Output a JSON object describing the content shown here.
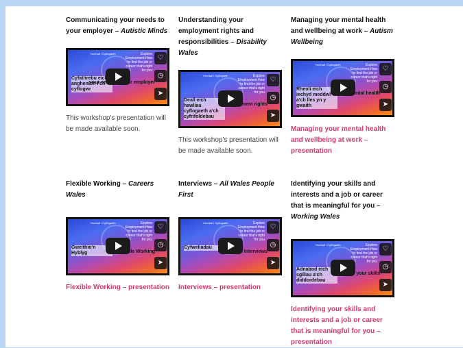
{
  "cards": [
    {
      "title_main": "Communicating your needs to your employer – ",
      "title_org": "Autistic Minds",
      "thumb_big": "Cyfathrebu eich anghenion i'ch cyflogwr",
      "thumb_right": "your needs to your employer",
      "footer": "This workshop's presentation will be made available soon."
    },
    {
      "title_main": "Understanding your employment rights and responsibilities – ",
      "title_org": "Disability Wales",
      "thumb_big": "Deall eich hawliau cyflogaeth a'ch cyfrifoldebau",
      "thumb_right": "employment rights",
      "footer": "This workshop's presentation will be made available soon."
    },
    {
      "title_main": "Managing your mental health and wellbeing at work – ",
      "title_org": "Autism Wellbeing",
      "thumb_big": "Rheoli eich iechyd meddwl a'ch lles yn y gwaith",
      "thumb_right": "mental health",
      "footer": "Managing your mental health and wellbeing at work – presentation"
    },
    {
      "title_main": "Flexible Working – ",
      "title_org": "Careers Wales",
      "thumb_big": "Gweithio'n Hyblyg",
      "thumb_right": "Flexible Working",
      "footer": "Flexible Working – presentation"
    },
    {
      "title_main": "Interviews – ",
      "title_org": "All Wales People First",
      "thumb_big": "Cyfweliadau",
      "thumb_right": "Interviews",
      "footer": "Interviews – presentation"
    },
    {
      "title_main": "Identifying your skills and interests and a job or career that is meaningful for you – ",
      "title_org": "Working Wales",
      "thumb_big": "Adnabod eich sgiliau a'ch diddordebau",
      "thumb_right": "your skills",
      "footer": "Identifying your skills and interests and a job or career that is meaningful for you – presentation"
    }
  ],
  "thumb_header_left": "Ymchwil i Gyflogaeth",
  "thumb_header_right": "Explore Employment How to find the job or career that's right for you",
  "icons": {
    "like": "heart-icon",
    "watch_later": "clock-icon",
    "share": "share-icon",
    "play": "play-icon"
  }
}
